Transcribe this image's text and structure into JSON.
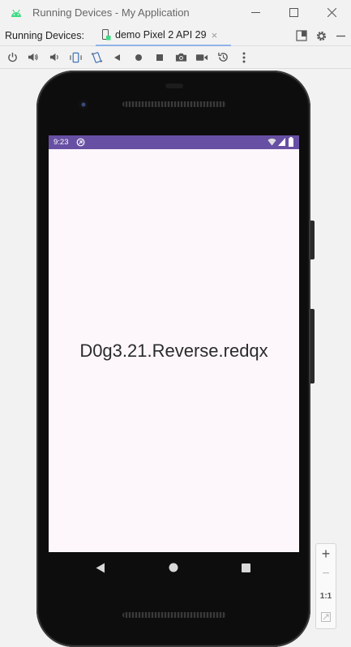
{
  "window": {
    "title": "Running Devices - My Application",
    "minimize_icon": "minimize-icon",
    "maximize_icon": "maximize-icon",
    "close_icon": "close-icon"
  },
  "device_bar": {
    "label": "Running Devices:",
    "tab_label": "demo Pixel 2 API 29",
    "tab_close": "×"
  },
  "toolbar": {
    "buttons": [
      "power",
      "volume-up",
      "volume-down",
      "rotate-left",
      "rotate-right",
      "back",
      "home",
      "overview",
      "screenshot",
      "screen-record",
      "snapshot",
      "more"
    ]
  },
  "device": {
    "status_time": "9:23",
    "app_text": "D0g3.21.Reverse.redqx",
    "status_bar_color": "#6750a4",
    "screen_background": "#fdf7fb"
  },
  "zoom": {
    "zoom_in": "+",
    "zoom_out": "−",
    "actual_size": "1:1"
  },
  "colors": {
    "accent": "#3d73b8",
    "android_green": "#3ddc84",
    "tab_underline": "#8fb4e8"
  }
}
